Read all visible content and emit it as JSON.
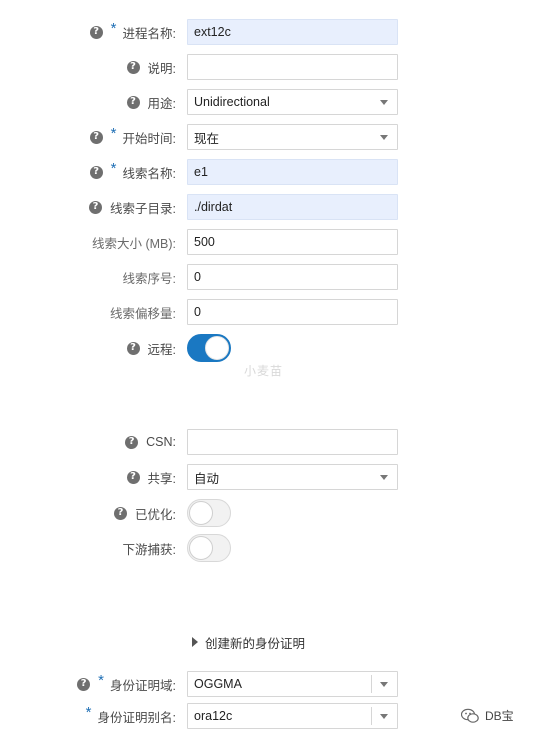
{
  "form": {
    "process_name": {
      "label": "进程名称:",
      "value": "ext12c"
    },
    "description": {
      "label": "说明:",
      "value": ""
    },
    "purpose": {
      "label": "用途:",
      "value": "Unidirectional"
    },
    "start_time": {
      "label": "开始时间:",
      "value": "现在"
    },
    "trail_name": {
      "label": "线索名称:",
      "value": "e1"
    },
    "trail_subdir": {
      "label": "线索子目录:",
      "value": "./dirdat"
    },
    "trail_size": {
      "label": "线索大小 (MB):",
      "value": "500"
    },
    "trail_seq": {
      "label": "线索序号:",
      "value": "0"
    },
    "trail_offset": {
      "label": "线索偏移量:",
      "value": "0"
    },
    "remote": {
      "label": "远程:",
      "on": true
    },
    "csn": {
      "label": "CSN:",
      "value": ""
    },
    "share": {
      "label": "共享:",
      "value": "自动"
    },
    "optimized": {
      "label": "已优化:",
      "on": false
    },
    "downstream": {
      "label": "下游捕获:",
      "on": false
    },
    "create_credential": {
      "label": "创建新的身份证明"
    },
    "credential_domain": {
      "label": "身份证明域:",
      "value": "OGGMA"
    },
    "credential_alias": {
      "label": "身份证明别名:",
      "value": "ora12c"
    }
  },
  "watermark": "小麦苗",
  "brand": {
    "text": "DB宝",
    "icon": "wechat-icon"
  },
  "glyphs": {
    "help": "?",
    "required": "*"
  },
  "colors": {
    "accent": "#1a78c2",
    "filled_bg": "#e8effd"
  }
}
